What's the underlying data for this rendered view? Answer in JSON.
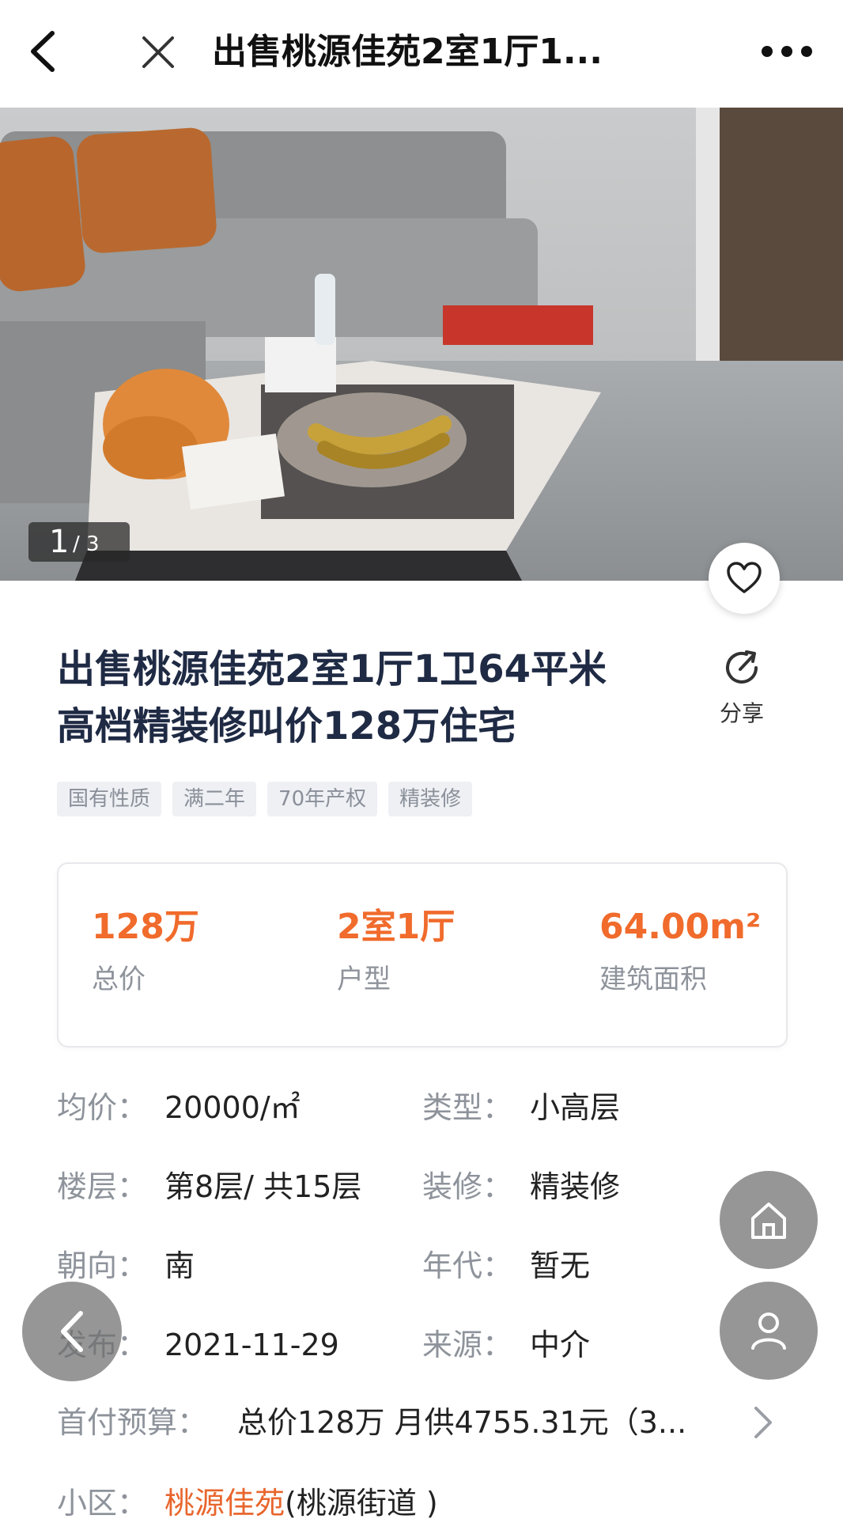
{
  "topbar": {
    "title": "出售桃源佳苑2室1厅1...",
    "back_icon": "chevron-left-icon",
    "close_icon": "close-icon",
    "more_icon": "more-horizontal-icon"
  },
  "gallery": {
    "current": "1",
    "total": "/ 3"
  },
  "listing": {
    "headline_line1": "出售桃源佳苑2室1厅1卫64平米",
    "headline_line2": "高档精装修叫价128万住宅",
    "share_label": "分享",
    "tags": [
      "国有性质",
      "满二年",
      "70年产权",
      "精装修"
    ]
  },
  "stats": {
    "price_value": "128万",
    "price_label": "总价",
    "layout_value": "2室1厅",
    "layout_label": "户型",
    "area_value": "64.00m²",
    "area_label": "建筑面积"
  },
  "info": {
    "rows": [
      {
        "k1": "均价：",
        "v1": "20000/㎡",
        "k2": "类型：",
        "v2": "小高层"
      },
      {
        "k1": "楼层：",
        "v1": "第8层/ 共15层",
        "k2": "装修：",
        "v2": "精装修"
      },
      {
        "k1": "朝向：",
        "v1": "南",
        "k2": "年代：",
        "v2": "暂无"
      },
      {
        "k1": "发布：",
        "v1": "2021-11-29",
        "k2": "来源：",
        "v2": "中介"
      }
    ],
    "down_payment_label": "首付预算：",
    "down_payment_value": "总价128万 月供4755.31元（3...",
    "community_label": "小区：",
    "community_link": "桃源佳苑",
    "community_rest": "(桃源街道 )"
  },
  "colors": {
    "accent": "#f06b2c",
    "title": "#1f2a44",
    "muted": "#8e939b"
  }
}
